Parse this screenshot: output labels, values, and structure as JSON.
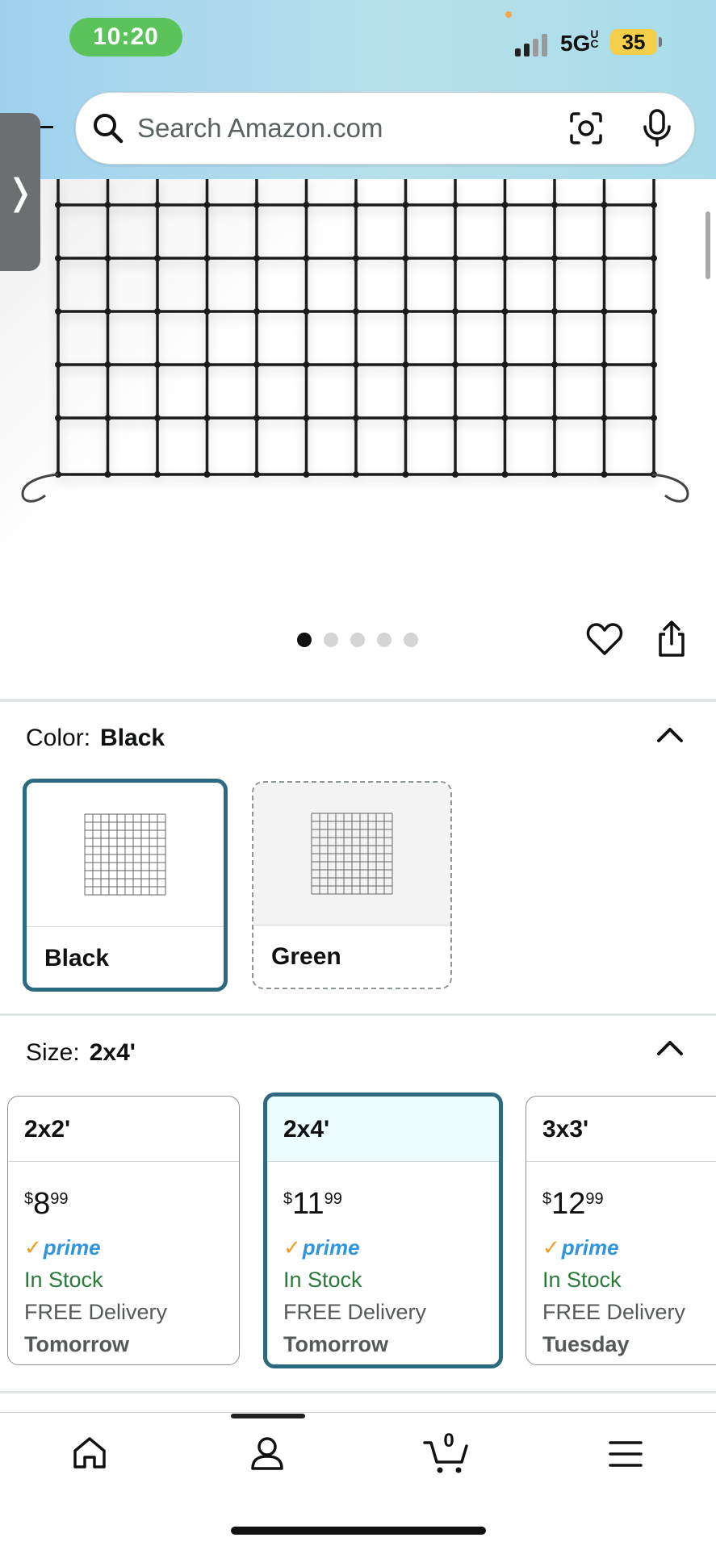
{
  "status_bar": {
    "time": "10:20",
    "network": "5G",
    "network_suffix": "UC",
    "battery": "35"
  },
  "search": {
    "placeholder": "Search Amazon.com"
  },
  "product_image": {
    "total_images": 5,
    "active_index": 0
  },
  "color": {
    "label": "Color:",
    "selected": "Black",
    "options": [
      {
        "label": "Black",
        "state": "selected"
      },
      {
        "label": "Green",
        "state": "unavailable"
      }
    ]
  },
  "size": {
    "label": "Size:",
    "selected": "2x4'",
    "options": [
      {
        "label": "2x2'",
        "currency": "$",
        "dollars": "8",
        "cents": "99",
        "prime": "prime",
        "stock": "In Stock",
        "delivery": "FREE Delivery",
        "delivery_day": "Tomorrow"
      },
      {
        "label": "2x4'",
        "currency": "$",
        "dollars": "11",
        "cents": "99",
        "prime": "prime",
        "stock": "In Stock",
        "delivery": "FREE Delivery",
        "delivery_day": "Tomorrow"
      },
      {
        "label": "3x3'",
        "currency": "$",
        "dollars": "12",
        "cents": "99",
        "prime": "prime",
        "stock": "In Stock",
        "delivery": "FREE Delivery",
        "delivery_day": "Tuesday"
      }
    ]
  },
  "bottom_nav": {
    "cart_count": "0"
  },
  "colors": {
    "selection_border": "#2e6a7f",
    "in_stock": "#2a7a3a",
    "prime_blue": "#2f95dd",
    "prime_check": "#f69b1f"
  }
}
